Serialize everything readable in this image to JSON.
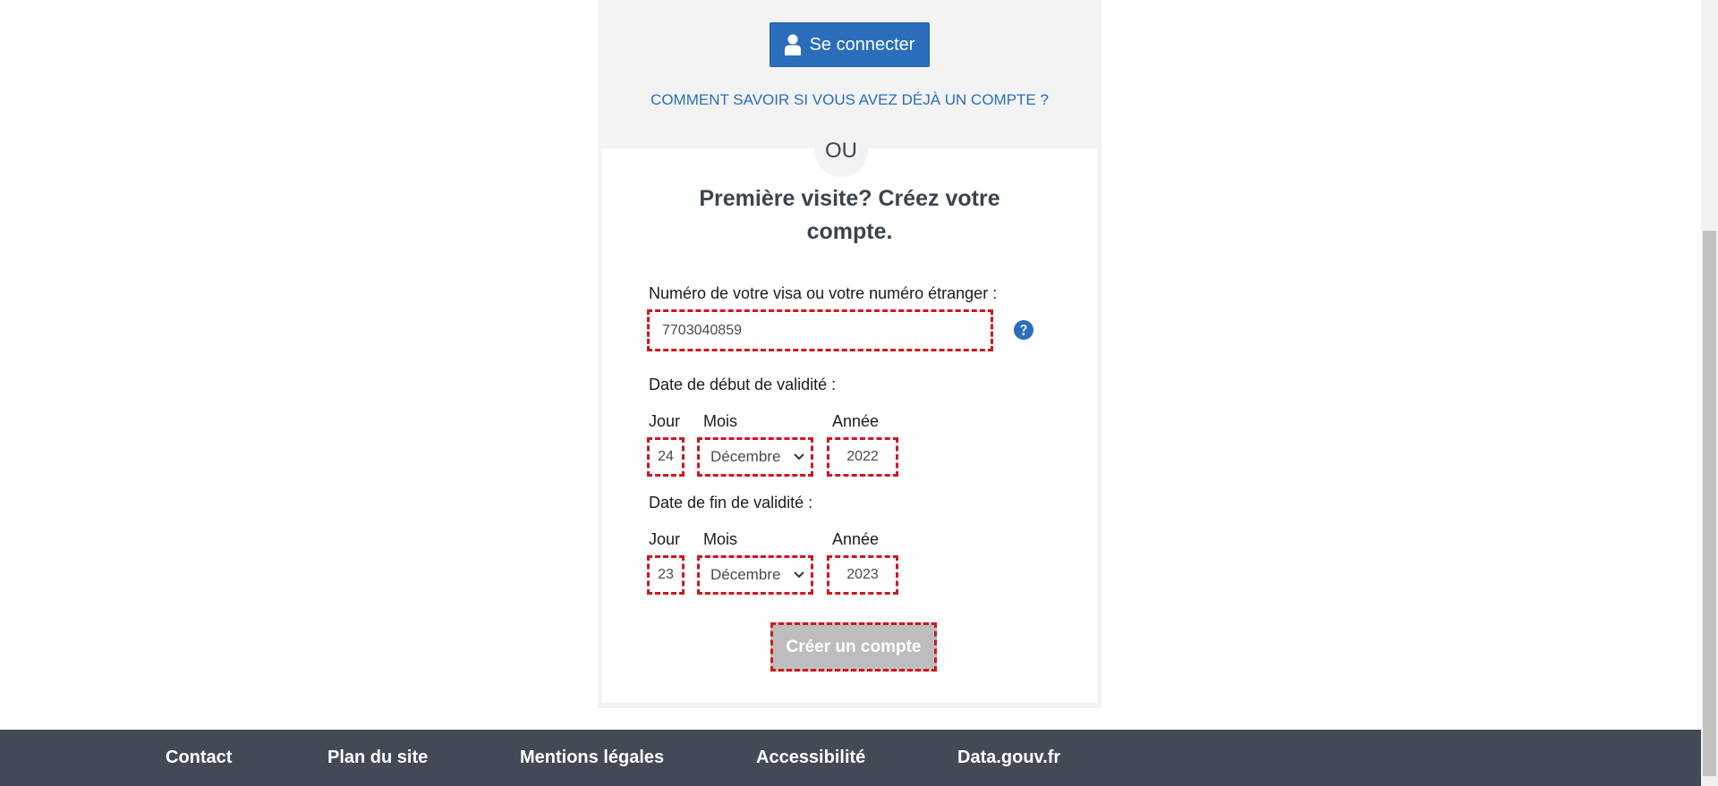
{
  "login": {
    "button_label": "Se connecter",
    "button_icon": "user-icon",
    "account_help_link": "COMMENT SAVOIR SI VOUS AVEZ DÉJÀ UN COMPTE ?"
  },
  "separator": "OU",
  "register": {
    "title": "Première visite? Créez votre compte.",
    "visa_label": "Numéro de votre visa ou votre numéro étranger :",
    "visa_value": "7703040859",
    "help_icon": "question-circle-icon",
    "start_date": {
      "label": "Date de début de validité :",
      "day_label": "Jour",
      "month_label": "Mois",
      "year_label": "Année",
      "day": "24",
      "month": "Décembre",
      "year": "2022"
    },
    "end_date": {
      "label": "Date de fin de validité :",
      "day_label": "Jour",
      "month_label": "Mois",
      "year_label": "Année",
      "day": "23",
      "month": "Décembre",
      "year": "2023"
    },
    "create_button": "Créer un compte"
  },
  "footer": {
    "links": [
      "Contact",
      "Plan du site",
      "Mentions légales",
      "Accessibilité",
      "Data.gouv.fr"
    ]
  },
  "colors": {
    "primary": "#2a6ebb",
    "error_outline": "#d0161c",
    "footer_bg": "#434a56",
    "disabled_button": "#bdbdbd"
  }
}
